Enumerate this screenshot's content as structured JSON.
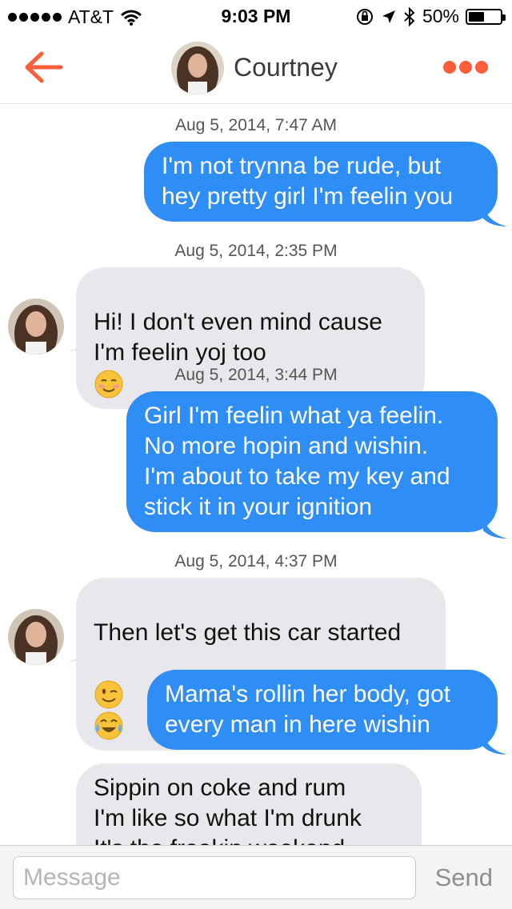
{
  "status_bar": {
    "carrier": "AT&T",
    "time": "9:03 PM",
    "battery": "50%",
    "battery_level": 0.5,
    "icons": [
      "signal-dots-icon",
      "wifi-icon",
      "orientation-lock-icon",
      "location-arrow-icon",
      "bluetooth-icon",
      "battery-icon"
    ]
  },
  "header": {
    "back_icon": "back-arrow-icon",
    "contact_name": "Courtney",
    "more_icon": "more-dots-icon",
    "accent_color": "#fd5e3a"
  },
  "messages": [
    {
      "timestamp": "Aug 5, 2014, 7:47 AM",
      "direction": "outgoing",
      "text": "I'm not trynna be rude, but\nhey pretty girl I'm feelin you"
    },
    {
      "timestamp": "Aug 5, 2014, 2:35 PM",
      "direction": "incoming",
      "text": "Hi! I don't even mind cause\nI'm feelin yoj too",
      "emojis": [
        "smiling-blush-emoji"
      ]
    },
    {
      "timestamp": "Aug 5, 2014, 3:44 PM",
      "direction": "outgoing",
      "text": "Girl I'm feelin what ya feelin.\nNo more hopin and wishin.\nI'm about to take my key and\nstick it in your ignition"
    },
    {
      "timestamp": "Aug 5, 2014, 4:37 PM",
      "direction": "incoming",
      "text": "Then let's get this car started",
      "emojis": [
        "winking-face-emoji",
        "tears-of-joy-emoji"
      ]
    },
    {
      "direction": "outgoing",
      "text": "Mama's rollin her body, got\nevery man in here wishin"
    },
    {
      "direction": "incoming",
      "text": "Sippin on coke and rum\nI'm like so what I'm drunk\nIt's the freakin weekend"
    }
  ],
  "composer": {
    "placeholder": "Message",
    "value": "",
    "send_label": "Send"
  },
  "colors": {
    "outgoing_bubble": "#2f8ef5",
    "incoming_bubble": "#e8e8ec"
  }
}
